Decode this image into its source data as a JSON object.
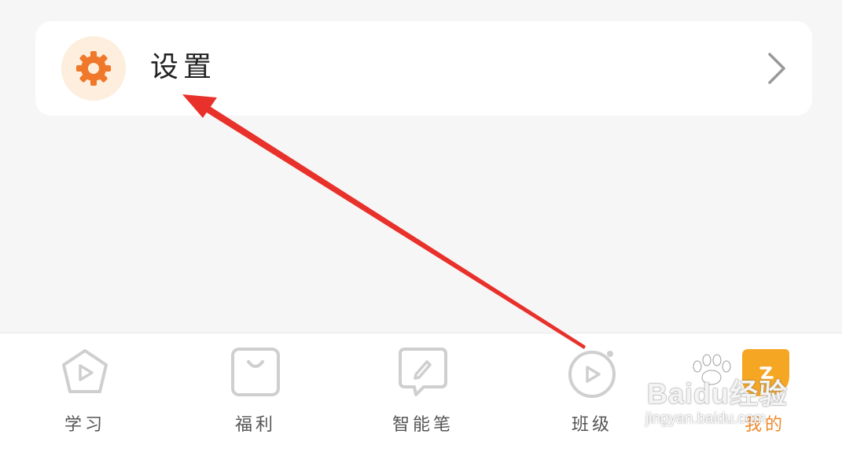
{
  "settings": {
    "label": "设置",
    "icon": "gear-icon",
    "accent": "#f0782a",
    "icon_bg": "#fdeedd"
  },
  "bottom_nav": {
    "items": [
      {
        "label": "学习",
        "icon": "play-pentagon-icon",
        "active": false
      },
      {
        "label": "福利",
        "icon": "bag-icon",
        "active": false
      },
      {
        "label": "智能笔",
        "icon": "pen-icon",
        "active": false
      },
      {
        "label": "班级",
        "icon": "class-play-icon",
        "active": false
      },
      {
        "label": "我的",
        "icon": "profile-icon",
        "active": true
      }
    ],
    "active_color": "#f08a2c",
    "inactive_color": "#555555"
  },
  "annotation": {
    "color": "#e8312b",
    "type": "arrow"
  },
  "watermark": {
    "brand": "Baidu经验",
    "url": "jingyan.baidu.com"
  }
}
